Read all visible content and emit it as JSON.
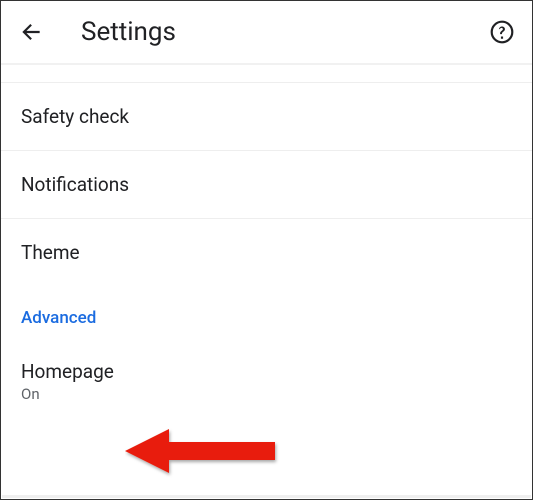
{
  "header": {
    "title": "Settings"
  },
  "rows": {
    "safety_check": "Safety check",
    "notifications": "Notifications",
    "theme": "Theme"
  },
  "section": {
    "advanced": "Advanced"
  },
  "homepage": {
    "label": "Homepage",
    "status": "On"
  }
}
